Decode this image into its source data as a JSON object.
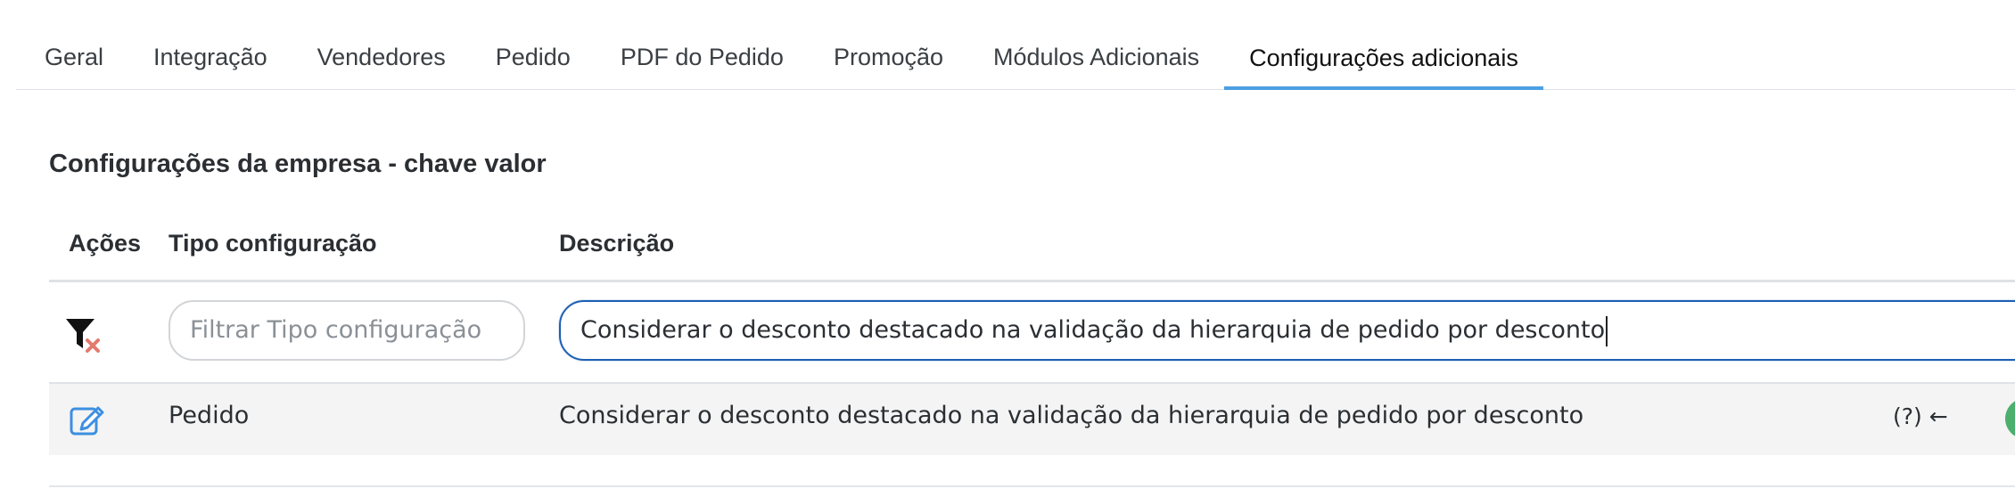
{
  "tabs": [
    {
      "label": "Geral",
      "active": false
    },
    {
      "label": "Integração",
      "active": false
    },
    {
      "label": "Vendedores",
      "active": false
    },
    {
      "label": "Pedido",
      "active": false
    },
    {
      "label": "PDF do Pedido",
      "active": false
    },
    {
      "label": "Promoção",
      "active": false
    },
    {
      "label": "Módulos Adicionais",
      "active": false
    },
    {
      "label": "Configurações adicionais",
      "active": true
    }
  ],
  "section": {
    "title": "Configurações da empresa - chave valor"
  },
  "table": {
    "headers": {
      "acoes": "Ações",
      "tipo": "Tipo configuração",
      "descricao": "Descrição"
    },
    "filters": {
      "clear_icon": "filter-clear-icon",
      "tipo_placeholder": "Filtrar Tipo configuração",
      "tipo_value": "",
      "descricao_value": "Considerar o desconto destacado na validação da hierarquia de pedido por desconto"
    },
    "rows": [
      {
        "action_icon": "edit-icon",
        "tipo": "Pedido",
        "descricao": "Considerar o desconto destacado na validação da hierarquia de pedido por desconto",
        "help": "(?) ←"
      }
    ]
  },
  "colors": {
    "active_tab": "#4a9fe3",
    "focused_input_border": "#1d5fb3",
    "edit_icon": "#3d8fe0",
    "status_dot": "#4caf6e",
    "filter_clear_x": "#e27a6d"
  }
}
